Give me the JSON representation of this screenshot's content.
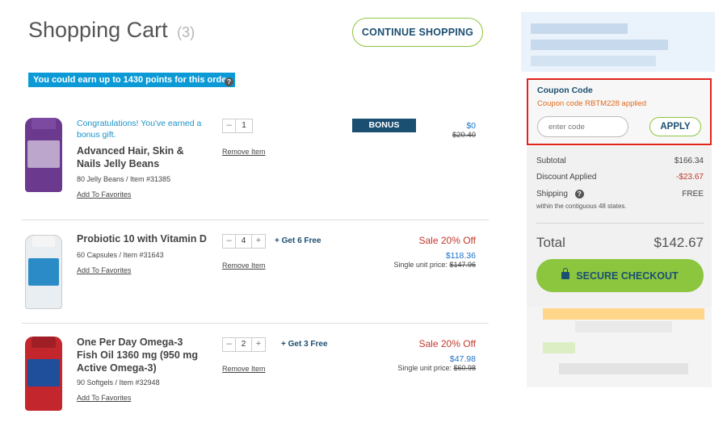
{
  "header": {
    "title": "Shopping Cart",
    "count": "(3)",
    "continue_label": "CONTINUE SHOPPING"
  },
  "points_banner": "You could earn up to 1430 points for this order",
  "help_glyph": "?",
  "items": [
    {
      "congrats": "Congratulations! You've earned a bonus gift.",
      "name": "Advanced Hair, Skin & Nails Jelly Beans",
      "meta": "80 Jelly Beans / Item #31385",
      "favorites": "Add To Favorites",
      "qty_minus": "–",
      "qty": "1",
      "remove": "Remove Item",
      "bonus": "BONUS",
      "price": "$0",
      "was": "$20.40"
    },
    {
      "name": "Probiotic 10 with Vitamin D",
      "meta": "60 Capsules / Item #31643",
      "favorites": "Add To Favorites",
      "qty_minus": "–",
      "qty": "4",
      "qty_plus": "+",
      "get_free": "+ Get 6 Free",
      "remove": "Remove Item",
      "sale": "Sale 20% Off",
      "price": "$118.36",
      "unit_label": "Single unit price:",
      "unit_was": "$147.96"
    },
    {
      "name": "One Per Day Omega-3 Fish Oil 1360 mg (950 mg Active Omega-3)",
      "meta": "90 Softgels / Item #32948",
      "favorites": "Add To Favorites",
      "qty_minus": "–",
      "qty": "2",
      "qty_plus": "+",
      "get_free": "+ Get 3 Free",
      "remove": "Remove Item",
      "sale": "Sale 20% Off",
      "price": "$47.98",
      "unit_label": "Single unit price:",
      "unit_was": "$60.98"
    }
  ],
  "coupon": {
    "title": "Coupon Code",
    "applied": "Coupon code RBTM228 applied",
    "placeholder": "enter code",
    "apply_label": "APPLY"
  },
  "summary": {
    "subtotal_label": "Subtotal",
    "subtotal": "$166.34",
    "discount_label": "Discount Applied",
    "discount": "-$23.67",
    "shipping_label": "Shipping",
    "shipping": "FREE",
    "shipping_note": "within the contiguous 48 states.",
    "total_label": "Total",
    "total": "$142.67",
    "checkout_label": "SECURE CHECKOUT"
  },
  "colors": {
    "accent_green": "#8cc63f",
    "brand_navy": "#1b4f72",
    "link_blue": "#1a93c8",
    "sale_red": "#c0392b",
    "highlight_red": "#e0241e"
  }
}
